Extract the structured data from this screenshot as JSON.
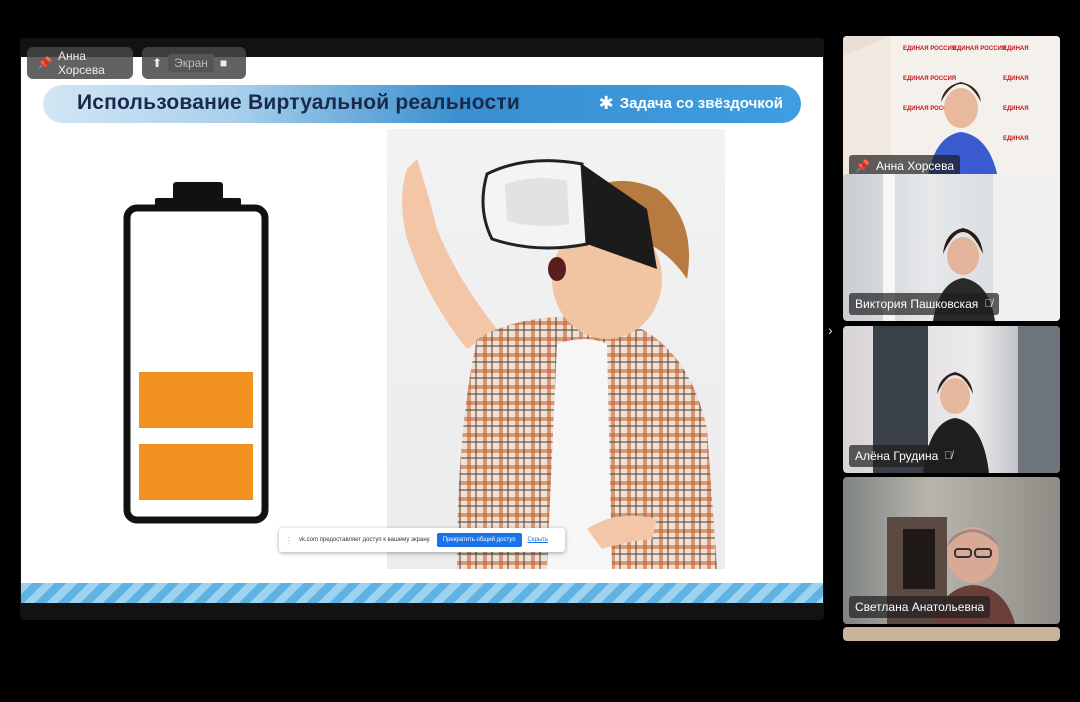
{
  "presenter_chip": {
    "name": "Анна Хорсева"
  },
  "screen_chip": {
    "label": "Экран"
  },
  "slide": {
    "title": "Использование Виртуальной реальности",
    "badge": "Задача со звёздочкой"
  },
  "share_bar": {
    "message": "vk.com предоставляет доступ к вашему экрану.",
    "stop_label": "Прекратить общий доступ",
    "hide_label": "Скрыть"
  },
  "participants": [
    {
      "name": "Анна Хорсева",
      "pinned": true,
      "muted": false
    },
    {
      "name": "Виктория Пашковская",
      "pinned": false,
      "muted": true
    },
    {
      "name": "Алёна Грудина",
      "pinned": false,
      "muted": true
    },
    {
      "name": "Светлана Анатольевна",
      "pinned": false,
      "muted": false
    }
  ],
  "battery": {
    "level_bars": 2,
    "total_bars": 5,
    "fill_color": "#f0901f"
  },
  "colors": {
    "title_text": "#1a2a4a",
    "accent_blue": "#3d9ee0",
    "button_blue": "#1a73e8"
  }
}
